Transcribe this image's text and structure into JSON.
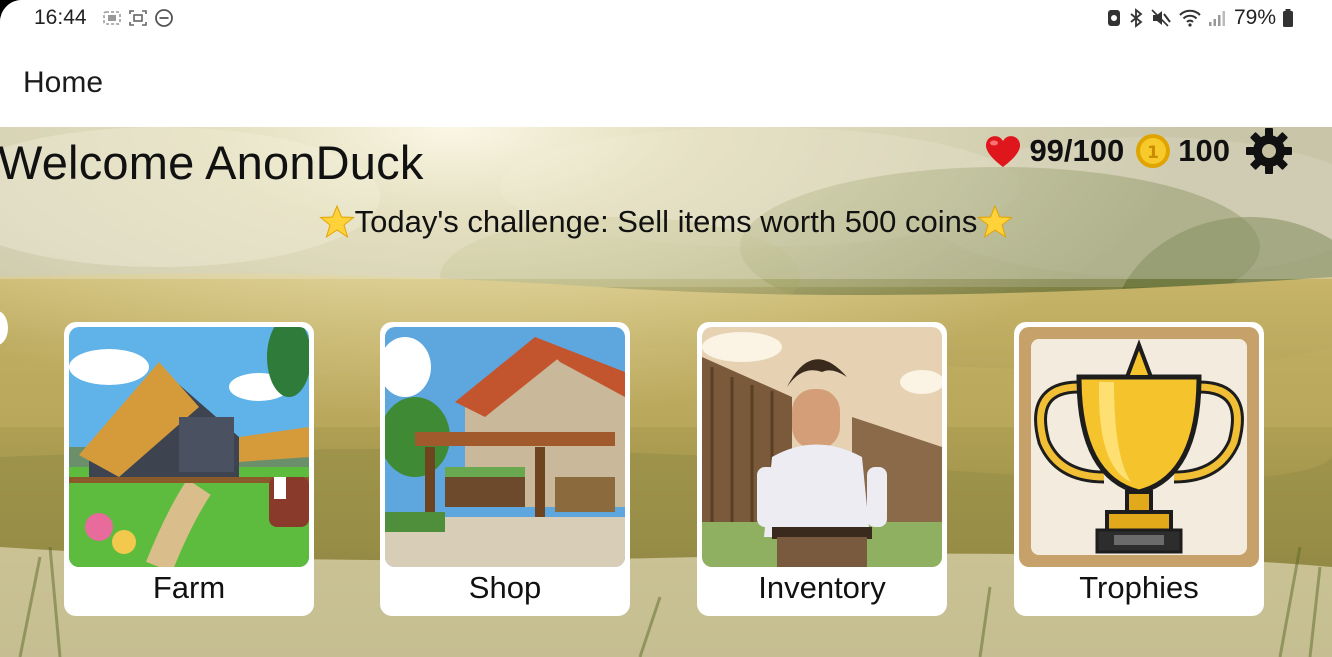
{
  "status_bar": {
    "time": "16:44",
    "battery_percent": "79%",
    "left_icons": [
      "screenshot-icon",
      "screen-record-icon",
      "do-not-disturb-icon"
    ],
    "right_icons": [
      "nfc-icon",
      "bluetooth-icon",
      "mute-icon",
      "wifi-icon",
      "signal-icon",
      "battery-icon"
    ]
  },
  "app_bar": {
    "title": "Home"
  },
  "header": {
    "welcome": "Welcome AnonDuck",
    "health": "99/100",
    "coins": "100",
    "health_icon": "heart-icon",
    "coins_icon": "coin-icon",
    "settings_icon": "gear-icon"
  },
  "challenge": {
    "text": "Today's challenge: Sell items worth 500 coins"
  },
  "menu": [
    {
      "label": "Farm",
      "image": "farm-barn-image"
    },
    {
      "label": "Shop",
      "image": "shop-market-image"
    },
    {
      "label": "Inventory",
      "image": "farmer-character-image"
    },
    {
      "label": "Trophies",
      "image": "trophy-image"
    }
  ],
  "colors": {
    "heart": "#e0161d",
    "coin": "#f2b705",
    "card_bg": "#ffffff",
    "text": "#111111"
  }
}
